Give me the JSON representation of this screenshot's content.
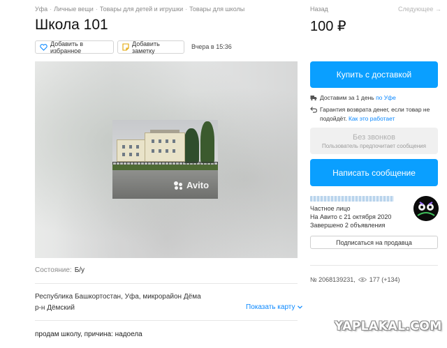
{
  "breadcrumbs": [
    "Уфа",
    "Личные вещи",
    "Товары для детей и игрушки",
    "Товары для школы"
  ],
  "title": "Школа 101",
  "actions": {
    "favorite": "Добавить в избранное",
    "note": "Добавить заметку"
  },
  "posted": "Вчера в 15:36",
  "gallery": {
    "watermark": "Avito"
  },
  "details": {
    "condition_label": "Состояние:",
    "condition_value": "Б/у",
    "address_line1": "Республика Башкортостан, Уфа, микрорайон Дёма",
    "address_line2": "р-н Дёмский",
    "show_map": "Показать карту",
    "description": "продам школу, причина: надоела"
  },
  "nav": {
    "back": "Назад",
    "next": "Следующее →"
  },
  "price": "100 ₽",
  "buy_button": "Купить с доставкой",
  "delivery": {
    "text": "Доставим за 1 день ",
    "link": "по Уфе"
  },
  "guarantee": {
    "text": "Гарантия возврата денег, если товар не подойдёт. ",
    "link": "Как это работает"
  },
  "no_calls": {
    "title": "Без звонков",
    "subtitle": "Пользователь предпочитает сообщения"
  },
  "write_button": "Написать сообщение",
  "seller": {
    "type": "Частное лицо",
    "since": "На Авито с 21 октября 2020",
    "completed": "Завершено 2 объявления",
    "subscribe": "Подписаться на продавца"
  },
  "stats": {
    "id": "№ 2068139231,",
    "views": "177 (+134)"
  },
  "site_watermark": "YAPLAKAL.COM",
  "colors": {
    "accent": "#0a9fff",
    "link": "#0a88ff"
  }
}
